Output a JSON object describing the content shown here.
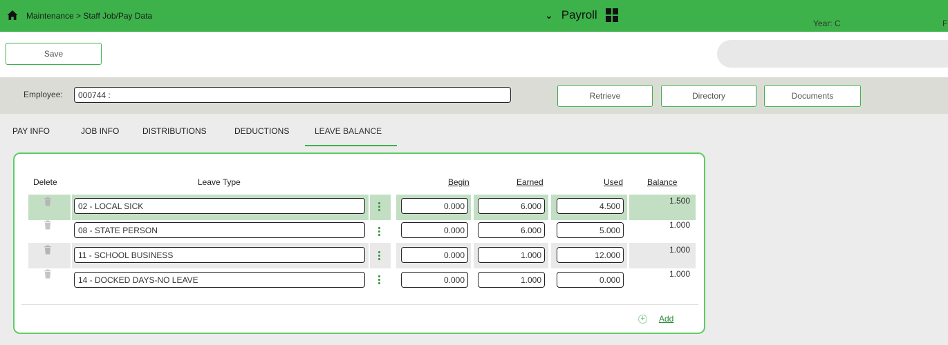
{
  "topbar": {
    "breadcrumb": "Maintenance > Staff Job/Pay Data",
    "module": "Payroll"
  },
  "toolbar": {
    "save_label": "Save",
    "year_label": "Year:",
    "year_value": "C",
    "f_label": "F"
  },
  "employee": {
    "label": "Employee:",
    "value": "000744 :",
    "retrieve_label": "Retrieve",
    "directory_label": "Directory",
    "documents_label": "Documents"
  },
  "tabs": [
    {
      "label": "PAY INFO"
    },
    {
      "label": "JOB INFO"
    },
    {
      "label": "DISTRIBUTIONS"
    },
    {
      "label": "DEDUCTIONS"
    },
    {
      "label": "LEAVE BALANCE",
      "active": true
    }
  ],
  "table": {
    "headers": {
      "delete": "Delete",
      "leave_type": "Leave Type",
      "begin": "Begin",
      "earned": "Earned",
      "used": "Used",
      "balance": "Balance"
    },
    "rows": [
      {
        "leave_type": "02 - LOCAL SICK",
        "begin": "0.000",
        "earned": "6.000",
        "used": "4.500",
        "balance": "1.500"
      },
      {
        "leave_type": "08 - STATE PERSON",
        "begin": "0.000",
        "earned": "6.000",
        "used": "5.000",
        "balance": "1.000"
      },
      {
        "leave_type": "11 - SCHOOL BUSINESS",
        "begin": "0.000",
        "earned": "1.000",
        "used": "12.000",
        "balance": "1.000"
      },
      {
        "leave_type": "14 - DOCKED DAYS-NO LEAVE",
        "begin": "0.000",
        "earned": "1.000",
        "used": "0.000",
        "balance": "1.000"
      }
    ],
    "add_label": "Add"
  },
  "colors": {
    "brand_green": "#3db24a",
    "selected_row": "#c2dfc4",
    "alt_row": "#e9e9e9"
  },
  "icons": [
    "home-icon",
    "chevron-down-icon",
    "apps-grid-icon",
    "trash-icon",
    "kebab-menu-icon",
    "add-circle-icon"
  ]
}
